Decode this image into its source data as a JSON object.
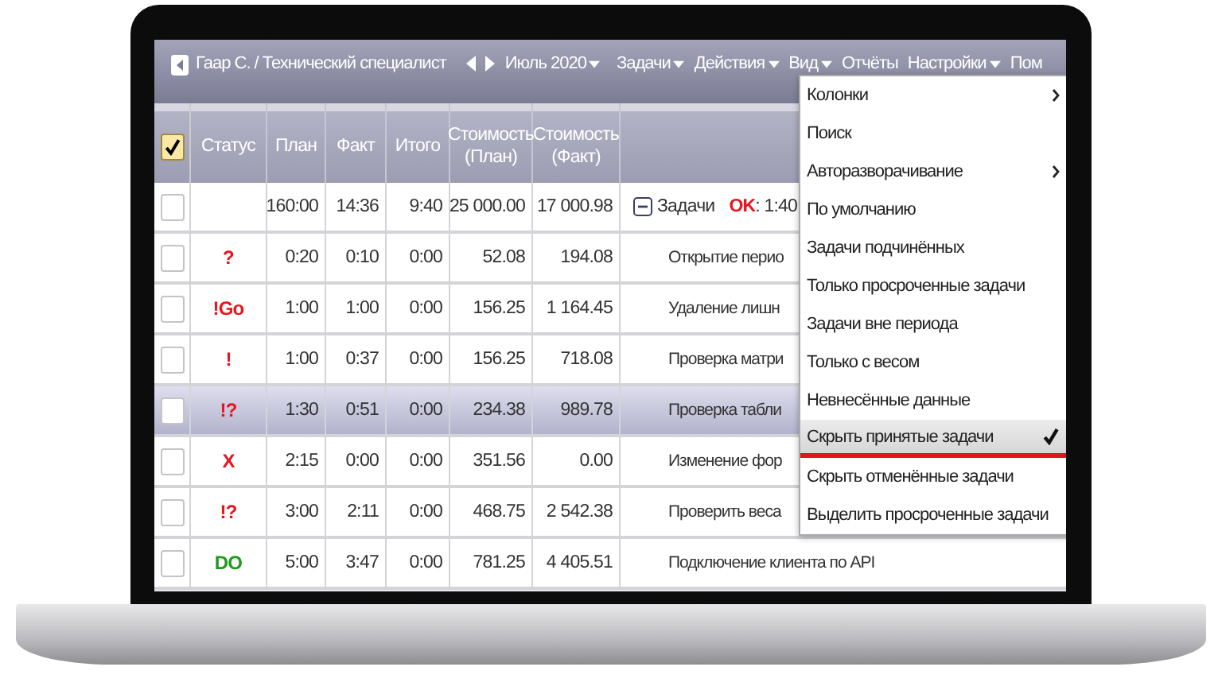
{
  "top_bar": {
    "user": "Гаар С. / Технический специалист",
    "period": "Июль 2020",
    "menus": [
      {
        "label": "Задачи",
        "dropdown": true
      },
      {
        "label": "Действия",
        "dropdown": true
      },
      {
        "label": "Вид",
        "dropdown": true
      },
      {
        "label": "Отчёты",
        "dropdown": false
      },
      {
        "label": "Настройки",
        "dropdown": true
      },
      {
        "label": "Пом",
        "dropdown": false
      }
    ]
  },
  "table": {
    "select_all": {
      "checked": true
    },
    "columns": [
      "Статус",
      "План",
      "Факт",
      "Итого",
      "Стоимость (План)",
      "Стоимость (Факт)"
    ],
    "rows": [
      {
        "kind": "summary",
        "checked": false,
        "selected": false,
        "plan": "160:00",
        "fact": "14:36",
        "total": "9:40",
        "cost_plan": "25 000.00",
        "cost_fact": "17 000.98",
        "label": "Задачи",
        "ok": "OK",
        "ok_value": ": 1:40"
      },
      {
        "kind": "task",
        "checked": false,
        "selected": false,
        "status": "?",
        "color": "#e8141e",
        "plan": "0:20",
        "fact": "0:10",
        "total": "0:00",
        "cost_plan": "52.08",
        "cost_fact": "194.08",
        "task": "Открытие перио"
      },
      {
        "kind": "task",
        "checked": false,
        "selected": false,
        "status": "!Go",
        "color": "#e8141e",
        "plan": "1:00",
        "fact": "1:00",
        "total": "0:00",
        "cost_plan": "156.25",
        "cost_fact": "1 164.45",
        "task": "Удаление лишн"
      },
      {
        "kind": "task",
        "checked": false,
        "selected": false,
        "status": "!",
        "color": "#e8141e",
        "plan": "1:00",
        "fact": "0:37",
        "total": "0:00",
        "cost_plan": "156.25",
        "cost_fact": "718.08",
        "task": "Проверка матри"
      },
      {
        "kind": "task",
        "checked": false,
        "selected": true,
        "status": "!?",
        "color": "#e8141e",
        "plan": "1:30",
        "fact": "0:51",
        "total": "0:00",
        "cost_plan": "234.38",
        "cost_fact": "989.78",
        "task": "Проверка табли"
      },
      {
        "kind": "task",
        "checked": false,
        "selected": false,
        "status": "X",
        "color": "#e8141e",
        "plan": "2:15",
        "fact": "0:00",
        "total": "0:00",
        "cost_plan": "351.56",
        "cost_fact": "0.00",
        "task": "Изменение фор"
      },
      {
        "kind": "task",
        "checked": false,
        "selected": false,
        "status": "!?",
        "color": "#e8141e",
        "plan": "3:00",
        "fact": "2:11",
        "total": "0:00",
        "cost_plan": "468.75",
        "cost_fact": "2 542.38",
        "task": "Проверить веса"
      },
      {
        "kind": "task",
        "checked": false,
        "selected": false,
        "status": "DO",
        "color": "#1f9a1f",
        "plan": "5:00",
        "fact": "3:47",
        "total": "0:00",
        "cost_plan": "781.25",
        "cost_fact": "4 405.51",
        "task": "Подключение клиента по API"
      }
    ]
  },
  "view_menu": {
    "items": [
      {
        "label": "Колонки",
        "submenu": true,
        "checked": false,
        "selected": false
      },
      {
        "label": "Поиск",
        "submenu": false,
        "checked": false,
        "selected": false
      },
      {
        "label": "Авторазворачивание",
        "submenu": true,
        "checked": false,
        "selected": false
      },
      {
        "label": "По умолчанию",
        "submenu": false,
        "checked": false,
        "selected": false
      },
      {
        "label": "Задачи подчинённых",
        "submenu": false,
        "checked": false,
        "selected": false
      },
      {
        "label": "Только просроченные задачи",
        "submenu": false,
        "checked": false,
        "selected": false
      },
      {
        "label": "Задачи вне периода",
        "submenu": false,
        "checked": false,
        "selected": false
      },
      {
        "label": "Только с весом",
        "submenu": false,
        "checked": false,
        "selected": false
      },
      {
        "label": "Невнесённые данные",
        "submenu": false,
        "checked": false,
        "selected": false
      },
      {
        "label": "Скрыть принятые задачи",
        "submenu": false,
        "checked": true,
        "selected": true
      },
      {
        "label": "Скрыть отменённые задачи",
        "submenu": false,
        "checked": false,
        "selected": false
      },
      {
        "label": "Выделить просроченные задачи",
        "submenu": false,
        "checked": false,
        "selected": false
      }
    ]
  }
}
